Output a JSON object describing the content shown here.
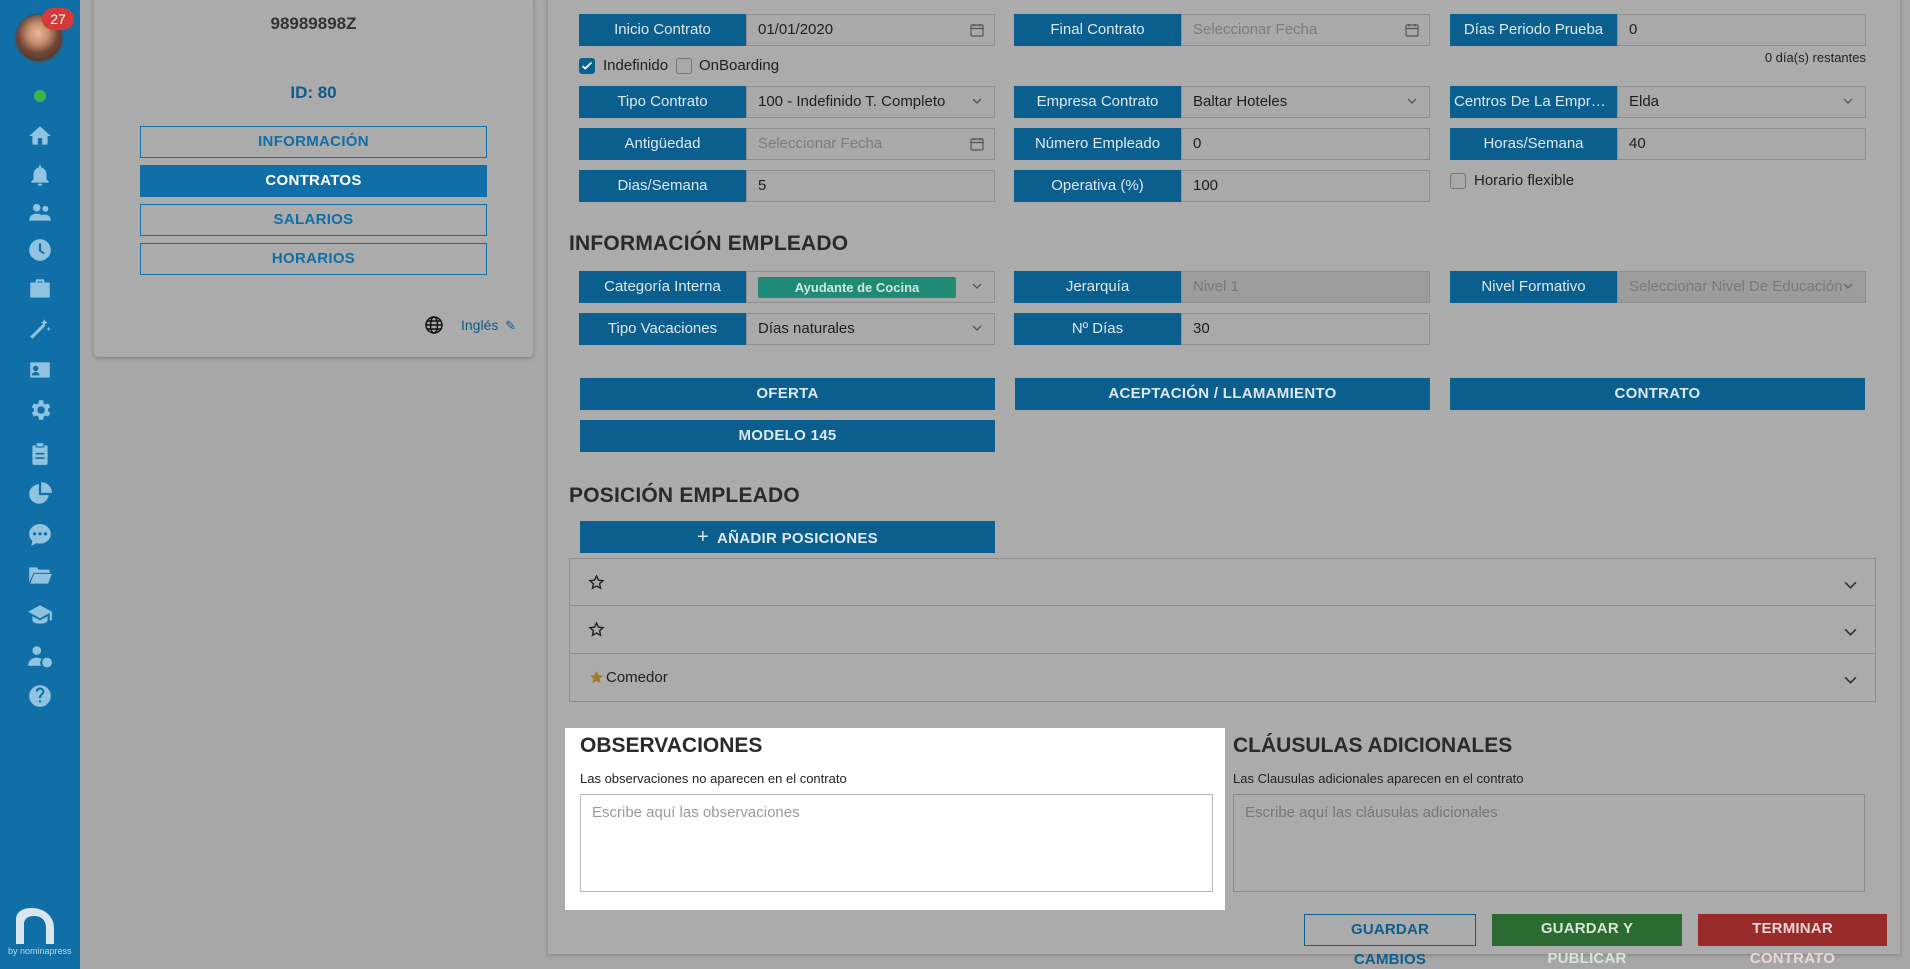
{
  "sidebar": {
    "badge_count": "27",
    "brand_text": "by nominapress",
    "icons": [
      "home-icon",
      "bell-icon",
      "users-icon",
      "clock-icon",
      "briefcase-icon",
      "magic-icon",
      "id-card-icon",
      "gear-icon",
      "clipboard-icon",
      "pie-chart-icon",
      "chat-icon",
      "folder-icon",
      "graduation-icon",
      "user-dollar-icon",
      "help-icon"
    ]
  },
  "employee": {
    "dni": "98989898Z",
    "id_label": "ID: 80",
    "menu": [
      "INFORMACIÓN",
      "CONTRATOS",
      "SALARIOS",
      "HORARIOS"
    ],
    "active_menu": "CONTRATOS",
    "language": "Inglés"
  },
  "contract": {
    "inicio_label": "Inicio Contrato",
    "inicio_value": "01/01/2020",
    "final_label": "Final Contrato",
    "final_placeholder": "Seleccionar Fecha",
    "prueba_label": "Días Periodo Prueba",
    "prueba_value": "0",
    "restantes": "0 día(s) restantes",
    "indefinido_label": "Indefinido",
    "indefinido_checked": true,
    "onboarding_label": "OnBoarding",
    "onboarding_checked": false,
    "tipo_label": "Tipo Contrato",
    "tipo_value": "100 - Indefinido T. Completo",
    "empresa_label": "Empresa Contrato",
    "empresa_value": "Baltar Hoteles",
    "centros_label": "Centros De La Empres...",
    "centros_value": "Elda",
    "antiguedad_label": "Antigüedad",
    "antiguedad_placeholder": "Seleccionar Fecha",
    "numero_label": "Número Empleado",
    "numero_value": "0",
    "horas_label": "Horas/Semana",
    "horas_value": "40",
    "dias_label": "Dias/Semana",
    "dias_value": "5",
    "operativa_label": "Operativa (%)",
    "operativa_value": "100",
    "flexible_label": "Horario flexible",
    "flexible_checked": false
  },
  "info_empleado": {
    "title": "INFORMACIÓN EMPLEADO",
    "categoria_label": "Categoría Interna",
    "categoria_value": "Ayudante de Cocina",
    "jerarquia_label": "Jerarquía",
    "jerarquia_placeholder": "Nivel 1",
    "formativo_label": "Nivel Formativo",
    "formativo_placeholder": "Seleccionar Nivel De Educación",
    "vacaciones_label": "Tipo Vacaciones",
    "vacaciones_value": "Días naturales",
    "ndias_label": "Nº Días",
    "ndias_value": "30"
  },
  "documents": {
    "oferta": "OFERTA",
    "aceptacion": "ACEPTACIÓN / LLAMAMIENTO",
    "contrato": "CONTRATO",
    "modelo": "MODELO 145"
  },
  "posicion": {
    "title": "POSICIÓN EMPLEADO",
    "add_label": "AÑADIR POSICIONES",
    "rows": [
      {
        "label": "",
        "starred": false
      },
      {
        "label": "",
        "starred": false
      },
      {
        "label": "Comedor",
        "starred": true
      }
    ]
  },
  "observaciones": {
    "title": "OBSERVACIONES",
    "hint": "Las observaciones no aparecen en el contrato",
    "placeholder": "Escribe aquí las observaciones"
  },
  "clausulas": {
    "title": "CLÁUSULAS ADICIONALES",
    "hint": "Las Clausulas adicionales aparecen en el contrato",
    "placeholder": "Escribe aquí las cláusulas adicionales"
  },
  "footer": {
    "save": "GUARDAR CAMBIOS",
    "publish": "GUARDAR Y PUBLICAR",
    "end": "TERMINAR CONTRATO"
  },
  "colors": {
    "primary": "#0f6fa6",
    "success": "#3aa845",
    "danger": "#d33b3b",
    "category_badge": "#2ec4a0"
  }
}
